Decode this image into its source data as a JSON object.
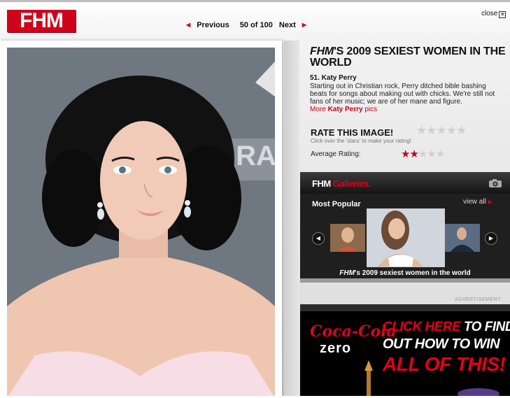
{
  "header": {
    "logo": "FHM",
    "prev_label": "Previous",
    "counter": "50 of 100",
    "next_label": "Next",
    "close_label": "close",
    "close_icon": "close-box-icon"
  },
  "photo": {
    "watermark": "GRA"
  },
  "article": {
    "title_brand": "FHM",
    "title_rest": "'S 2009 SEXIEST WOMEN IN THE WORLD",
    "entry_name": "51. Katy Perry",
    "entry_text": "Starting out in Christian rock, Perry ditched bible bashing beats for songs about making out with chicks. We're still not fans of her music; we are of her mane and figure.",
    "more_prefix": "More ",
    "more_name": "Katy Perry",
    "more_suffix": " pics"
  },
  "rating": {
    "title": "RATE THIS IMAGE!",
    "stars": "★★★★★",
    "hint": "Click over the 'stars' to make your rating!",
    "avg_label": "Average Rating:",
    "avg_filled": "★★",
    "avg_empty": "★★★",
    "avg_value": 2,
    "avg_max": 5
  },
  "galleries": {
    "brand_fhm": "FHM",
    "brand_word": "Galleries.",
    "camera_icon": "camera-icon",
    "most_popular": "Most Popular",
    "view_all": "view all",
    "caption_brand": "FHM",
    "caption_rest": "'s 2009 sexiest women in the world",
    "prev_icon": "arrow-left-icon",
    "next_icon": "arrow-right-icon"
  },
  "ad": {
    "label": "ADVERTISEMENT",
    "brand": "Coca-Cola",
    "product": "zero",
    "line1_red": "CLICK HERE",
    "line1_white": " TO FIND",
    "line2": "OUT HOW TO WIN",
    "line3": "ALL OF THIS!"
  },
  "colors": {
    "brand_red": "#d0021b",
    "gallery_bg": "#1f1f1f",
    "star_on": "#c8001a",
    "star_off": "#cfcfcf"
  }
}
